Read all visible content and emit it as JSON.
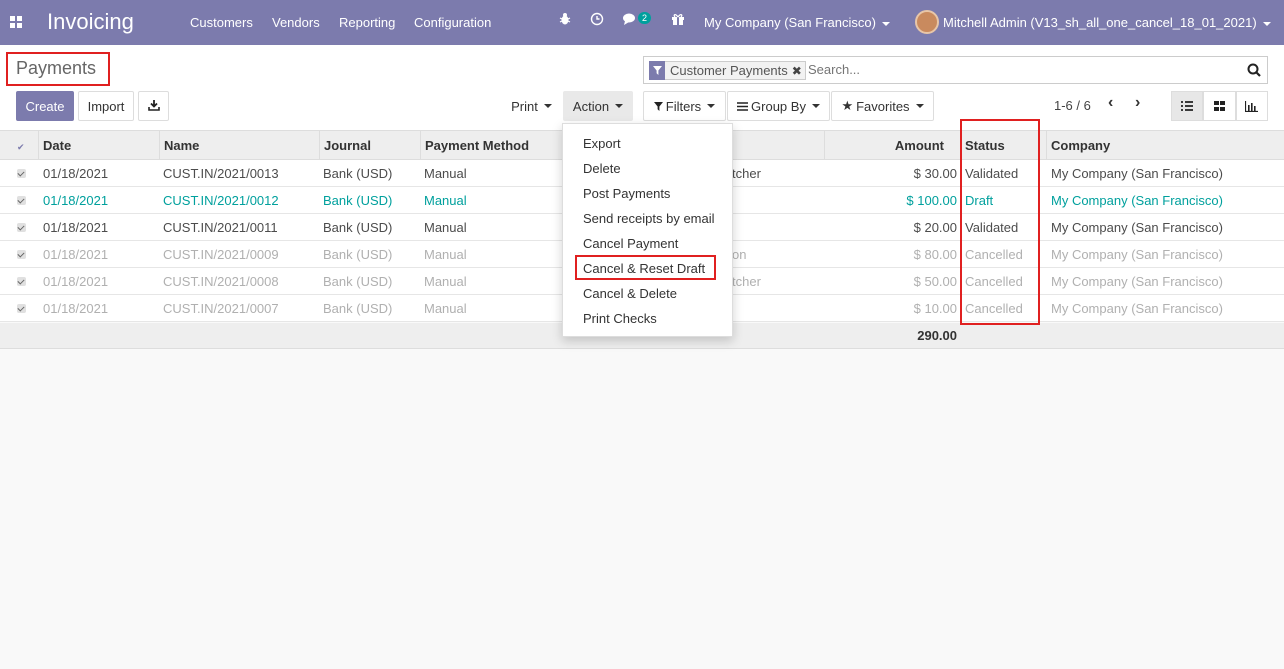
{
  "navbar": {
    "app_title": "Invoicing",
    "menu": [
      "Customers",
      "Vendors",
      "Reporting",
      "Configuration"
    ],
    "messages_count": "2",
    "company": "My Company (San Francisco)",
    "user": "Mitchell Admin (V13_sh_all_one_cancel_18_01_2021)"
  },
  "page": {
    "title": "Payments"
  },
  "search": {
    "facet": "Customer Payments",
    "placeholder": "Search..."
  },
  "toolbar": {
    "create": "Create",
    "import": "Import",
    "print": "Print",
    "action": "Action",
    "filters": "Filters",
    "group_by": "Group By",
    "favorites": "Favorites",
    "pager": "1-6 / 6"
  },
  "table": {
    "columns": [
      "Date",
      "Name",
      "Journal",
      "Payment Method",
      "",
      "Amount",
      "Status",
      "Company"
    ],
    "rows": [
      {
        "date": "01/18/2021",
        "name": "CUST.IN/2021/0013",
        "journal": "Bank (USD)",
        "method": "Manual",
        "partner": "tcher",
        "amount": "$ 30.00",
        "status": "Validated",
        "company": "My Company (San Francisco)",
        "state": "validated"
      },
      {
        "date": "01/18/2021",
        "name": "CUST.IN/2021/0012",
        "journal": "Bank (USD)",
        "method": "Manual",
        "partner": "",
        "amount": "$ 100.00",
        "status": "Draft",
        "company": "My Company (San Francisco)",
        "state": "draft"
      },
      {
        "date": "01/18/2021",
        "name": "CUST.IN/2021/0011",
        "journal": "Bank (USD)",
        "method": "Manual",
        "partner": "",
        "amount": "$ 20.00",
        "status": "Validated",
        "company": "My Company (San Francisco)",
        "state": "validated"
      },
      {
        "date": "01/18/2021",
        "name": "CUST.IN/2021/0009",
        "journal": "Bank (USD)",
        "method": "Manual",
        "partner": "on",
        "amount": "$ 80.00",
        "status": "Cancelled",
        "company": "My Company (San Francisco)",
        "state": "cancelled"
      },
      {
        "date": "01/18/2021",
        "name": "CUST.IN/2021/0008",
        "journal": "Bank (USD)",
        "method": "Manual",
        "partner": "tcher",
        "amount": "$ 50.00",
        "status": "Cancelled",
        "company": "My Company (San Francisco)",
        "state": "cancelled"
      },
      {
        "date": "01/18/2021",
        "name": "CUST.IN/2021/0007",
        "journal": "Bank (USD)",
        "method": "Manual",
        "partner": "",
        "amount": "$ 10.00",
        "status": "Cancelled",
        "company": "My Company (San Francisco)",
        "state": "cancelled"
      }
    ],
    "total": "290.00"
  },
  "action_menu": {
    "items": [
      "Export",
      "Delete",
      "Post Payments",
      "Send receipts by email",
      "Cancel Payment",
      "Cancel & Reset Draft",
      "Cancel & Delete",
      "Print Checks"
    ]
  },
  "colors": {
    "brand": "#7c7bad",
    "draft": "#00a09d",
    "highlight": "#e02020"
  }
}
